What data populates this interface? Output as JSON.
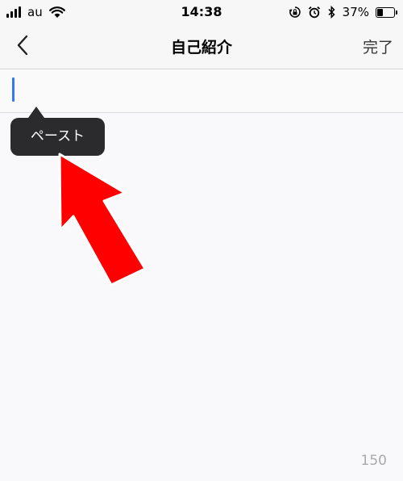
{
  "status_bar": {
    "carrier": "au",
    "time": "14:38",
    "battery_percent_text": "37%",
    "battery_level": 0.37,
    "icons": [
      "signal-icon",
      "wifi-icon",
      "orientation-lock-icon",
      "alarm-icon",
      "bluetooth-icon",
      "battery-icon"
    ]
  },
  "nav_bar": {
    "title": "自己紹介",
    "done_label": "完了",
    "back_icon": "chevron-left-icon"
  },
  "editor": {
    "value": "",
    "caret_color": "#3478f6"
  },
  "context_menu": {
    "paste_label": "ペースト"
  },
  "annotation": {
    "arrow_color": "#ff0000"
  },
  "counter": {
    "remaining": "150"
  }
}
